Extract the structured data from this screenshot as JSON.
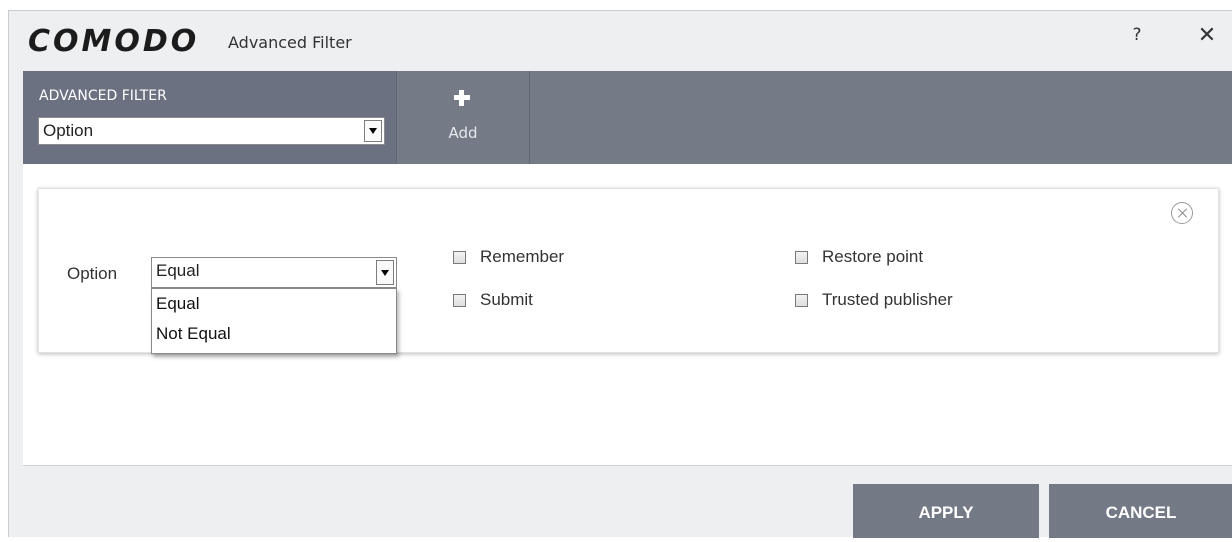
{
  "window": {
    "brand": "COMODO",
    "title": "Advanced Filter",
    "help_label": "?",
    "close_label": "✕"
  },
  "toolbar": {
    "filter_label": "ADVANCED FILTER",
    "filter_select_value": "Option",
    "add_label": "Add"
  },
  "filter_row": {
    "field_label": "Option",
    "condition_value": "Equal",
    "condition_options": [
      "Equal",
      "Not Equal"
    ],
    "checkboxes": [
      {
        "label": "Remember",
        "checked": false
      },
      {
        "label": "Submit",
        "checked": false
      },
      {
        "label": "Restore point",
        "checked": false
      },
      {
        "label": "Trusted publisher",
        "checked": false
      }
    ]
  },
  "footer": {
    "apply_label": "APPLY",
    "cancel_label": "CANCEL"
  },
  "colors": {
    "toolbar": "#747a86",
    "button": "#737985",
    "window_bg": "#eeeff1"
  }
}
